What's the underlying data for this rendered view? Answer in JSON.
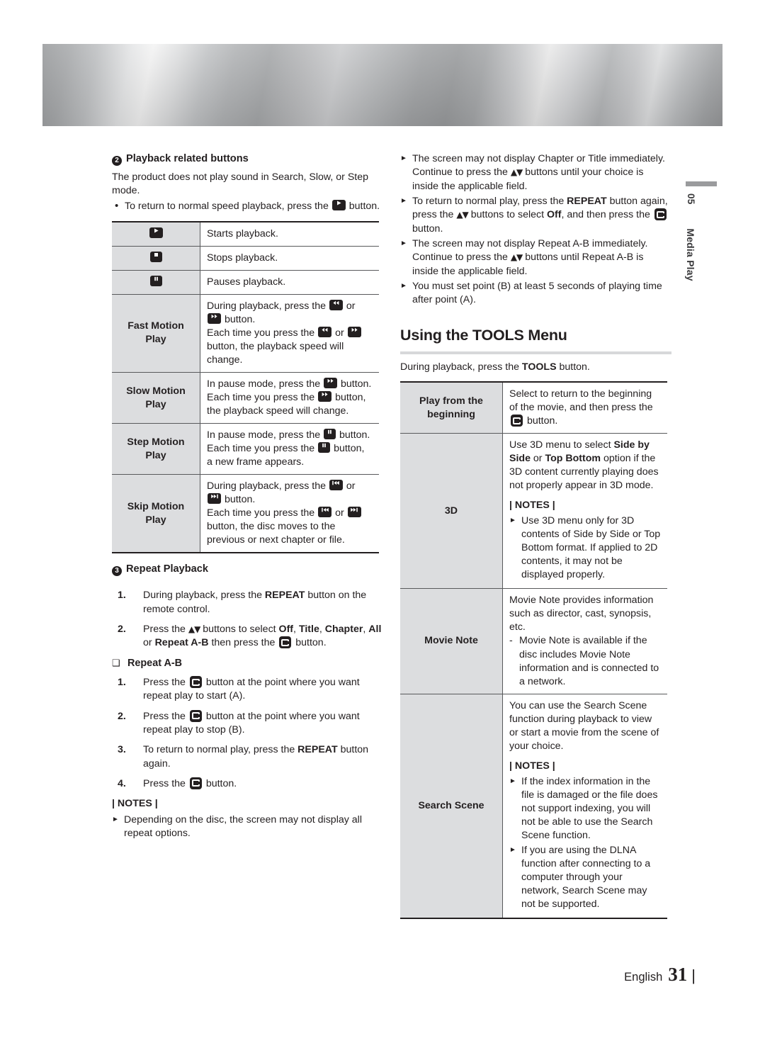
{
  "sidetab": {
    "number": "05",
    "label": "Media Play"
  },
  "footer": {
    "language": "English",
    "page": "31",
    "bar": "|"
  },
  "left": {
    "section2": {
      "marker": "2",
      "title": "Playback related buttons",
      "intro": "The product does not play sound in Search, Slow, or Step mode.",
      "bullet": "To return to normal speed playback, press the  button."
    },
    "playback_table": [
      {
        "key_icon": "play-icon",
        "key_text": "",
        "value": "Starts playback."
      },
      {
        "key_icon": "stop-icon",
        "key_text": "",
        "value": "Stops playback."
      },
      {
        "key_icon": "pause-icon",
        "key_text": "",
        "value": "Pauses playback."
      },
      {
        "key_icon": "",
        "key_text": "Fast Motion Play",
        "value": "During playback, press the  or  button. Each time you press the  or  button, the playback speed will change."
      },
      {
        "key_icon": "",
        "key_text": "Slow Motion Play",
        "value": "In pause mode, press the  button. Each time you press the  button, the playback speed will change."
      },
      {
        "key_icon": "",
        "key_text": "Step Motion Play",
        "value": "In pause mode, press the  button. Each time you press the  button, a new frame appears."
      },
      {
        "key_icon": "",
        "key_text": "Skip Motion Play",
        "value": "During playback, press the  or  button. Each time you press the  or  button, the disc moves to the previous or next chapter or file."
      }
    ],
    "section3": {
      "marker": "3",
      "title": "Repeat Playback",
      "steps": [
        {
          "n": "1.",
          "text": "During playback, press the REPEAT button on the remote control."
        },
        {
          "n": "2.",
          "text": "Press the ▲▼ buttons to select Off, Title, Chapter, All or Repeat A-B then press the  button."
        }
      ],
      "subsection": "Repeat A-B",
      "ab_steps": [
        {
          "n": "1.",
          "text": "Press the  button at the point where you want repeat play to start (A)."
        },
        {
          "n": "2.",
          "text": "Press the  button at the point where you want repeat play to stop (B)."
        },
        {
          "n": "3.",
          "text": "To return to normal play, press the REPEAT button again."
        },
        {
          "n": "4.",
          "text": "Press the  button."
        }
      ],
      "notes_title": "| NOTES |",
      "notes": [
        "Depending on the disc, the screen may not display all repeat options."
      ]
    }
  },
  "right": {
    "top_notes": [
      "The screen may not display Chapter or Title immediately. Continue to press the ▲▼ buttons until your choice is inside the applicable field.",
      "To return to normal play, press the REPEAT button again, press the ▲▼ buttons to select Off, and then press the  button.",
      "The screen may not display Repeat A-B immediately. Continue to press the ▲▼ buttons until Repeat A-B is inside the applicable field.",
      "You must set point (B) at least 5 seconds of playing time after point (A)."
    ],
    "heading": "Using the TOOLS Menu",
    "subintro": "During playback, press the TOOLS button.",
    "tools_table": [
      {
        "key": "Play from the beginning",
        "value": "Select to return to the beginning of the movie, and then press the  button."
      },
      {
        "key": "3D",
        "value": "Use 3D menu to select Side by Side or Top Bottom option if the 3D content currently playing does not properly appear in 3D mode.",
        "notes_title": "| NOTES |",
        "notes": [
          "Use 3D menu only for 3D contents of Side by Side or Top Bottom format. If applied to 2D contents, it may not be displayed properly."
        ]
      },
      {
        "key": "Movie Note",
        "value": "Movie Note provides information such as director, cast, synopsis, etc.",
        "dash_items": [
          "Movie Note is available if the disc includes Movie Note information and is connected to a network."
        ]
      },
      {
        "key": "Search Scene",
        "value": "You can use the Search Scene function during playback to view or start a movie from the scene of your choice.",
        "notes_title": "| NOTES |",
        "notes": [
          "If the index information in the file is damaged or the file does not support indexing, you will not be able to use the Search Scene function.",
          "If you are using the DLNA function after connecting to a computer through your network, Search Scene may not be supported."
        ]
      }
    ]
  },
  "colors": {
    "table_key_bg": "#dcdddf",
    "rule": "#d7d8da",
    "text": "#231f20"
  }
}
